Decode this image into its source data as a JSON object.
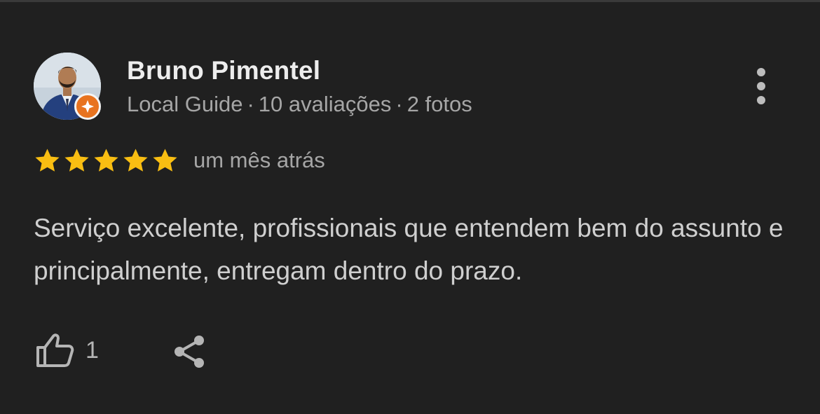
{
  "review": {
    "author_name": "Bruno Pimentel",
    "meta_role": "Local Guide",
    "meta_reviews": "10 avaliações",
    "meta_photos": "2 fotos",
    "meta_separator": "·",
    "rating": 5,
    "rating_max": 5,
    "time_ago": "um mês atrás",
    "text": "Serviço excelente, profissionais que entendem bem do assunto e principalmente, entregam dentro do prazo.",
    "like_count": "1"
  },
  "colors": {
    "background": "#202020",
    "star": "#f9be12",
    "badge": "#e8731f",
    "name": "#ededed",
    "secondary_text": "#a6a6a6",
    "body_text": "#cfcfcf"
  },
  "icons": {
    "avatar": "profile-photo",
    "badge": "local-guide-badge-icon",
    "more": "more-vertical-icon",
    "star": "star-icon",
    "like": "thumbs-up-icon",
    "share": "share-icon"
  }
}
